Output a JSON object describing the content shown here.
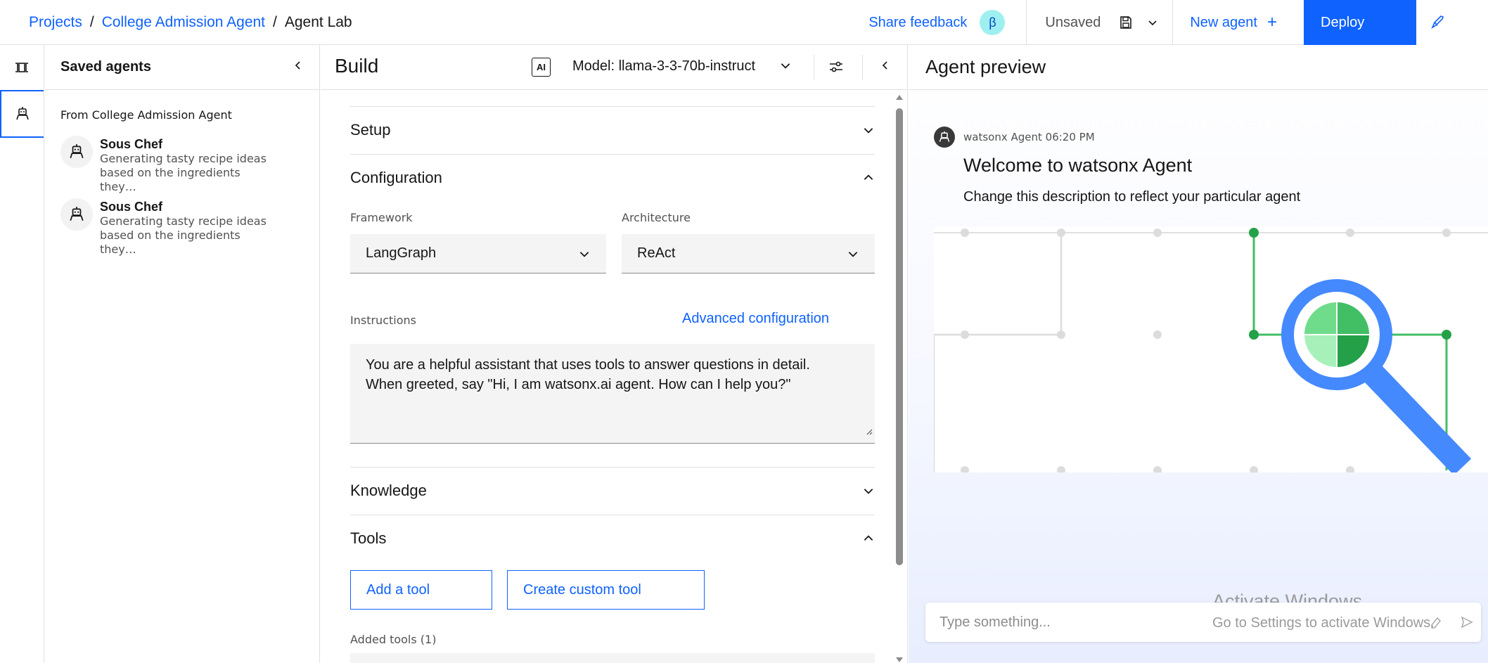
{
  "breadcrumb": {
    "project_label": "Projects",
    "project_name": "College Admission Agent",
    "current": "Agent Lab",
    "separator": "/"
  },
  "topbar": {
    "feedback_label": "Share feedback",
    "beta_badge": "β",
    "status": "Unsaved",
    "new_agent_label": "New agent",
    "new_agent_plus": "+",
    "deploy_label": "Deploy"
  },
  "saved_agents": {
    "title": "Saved agents",
    "source_label": "From College Admission Agent",
    "items": [
      {
        "name": "Sous Chef",
        "desc_line1": "Generating tasty recipe ideas",
        "desc_line2": "based on the ingredients they…"
      },
      {
        "name": "Sous Chef",
        "desc_line1": "Generating tasty recipe ideas",
        "desc_line2": "based on the ingredients they…"
      }
    ]
  },
  "build": {
    "title": "Build",
    "ai_badge": "AI",
    "model_label": "Model: llama-3-3-70b-instruct",
    "sections": {
      "setup": "Setup",
      "configuration": "Configuration",
      "knowledge": "Knowledge",
      "tools": "Tools"
    },
    "framework": {
      "label": "Framework",
      "value": "LangGraph"
    },
    "architecture": {
      "label": "Architecture",
      "value": "ReAct"
    },
    "instructions": {
      "label": "Instructions",
      "advanced_link": "Advanced configuration",
      "line1": "You are a helpful assistant that uses tools to answer questions in detail.",
      "line2": "When greeted, say \"Hi, I am watsonx.ai agent. How can I help you?\""
    },
    "tools": {
      "add_tool": "Add a tool",
      "create_custom_tool": "Create custom tool",
      "added_tools_label": "Added tools (1)"
    }
  },
  "preview": {
    "title": "Agent preview",
    "message_meta": "watsonx Agent 06:20 PM",
    "welcome_title": "Welcome to watsonx Agent",
    "welcome_desc": "Change this description to reflect your particular agent",
    "input_placeholder": "Type something...",
    "watermark_title": "Activate Windows",
    "watermark_sub": "Go to Settings to activate Windows."
  },
  "colors": {
    "accent": "#0f62fe",
    "beta_bg": "#9ef0f0",
    "illustration_green": "#24a148",
    "illustration_blue": "#4589ff"
  },
  "icons": {
    "rail_top": "panel-toggle-icon",
    "rail_agent": "agent-icon",
    "save": "save-icon",
    "deploy": "rocket-icon",
    "model_tune": "settings-adjust-icon"
  }
}
